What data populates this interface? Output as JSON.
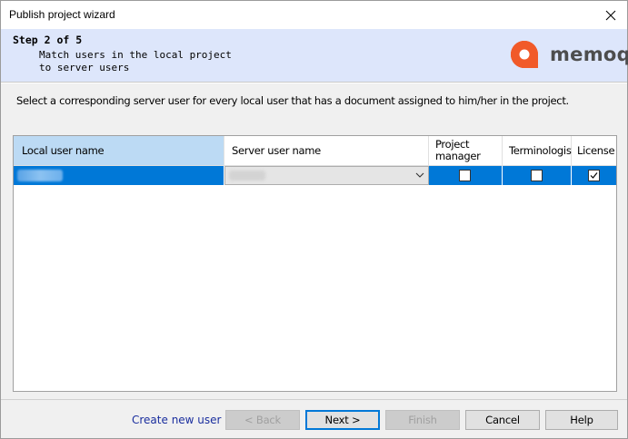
{
  "window": {
    "title": "Publish project wizard"
  },
  "header": {
    "step": "Step 2 of 5",
    "description": "Match users in the local project\nto server users",
    "logo_text": "memoq",
    "logo_color": "#f15a29"
  },
  "instruction": "Select a corresponding server user for every local user that has a document assigned to him/her in the project.",
  "grid": {
    "columns": {
      "local_user": "Local user name",
      "server_user": "Server user name",
      "project_manager": "Project\nmanager",
      "terminologist": "Terminologist",
      "license": "License"
    },
    "rows": [
      {
        "local_user": "",
        "server_user": "",
        "project_manager": false,
        "terminologist": false,
        "license": true,
        "selected": true
      }
    ]
  },
  "footer": {
    "create_user_link": "Create new user",
    "back_label": "< Back",
    "next_label": "Next >",
    "finish_label": "Finish",
    "cancel_label": "Cancel",
    "help_label": "Help"
  },
  "colors": {
    "selection": "#0078d7",
    "header_bg": "#dde6fb",
    "selected_column_header": "#bcdaf4",
    "link": "#1a2e9e"
  }
}
